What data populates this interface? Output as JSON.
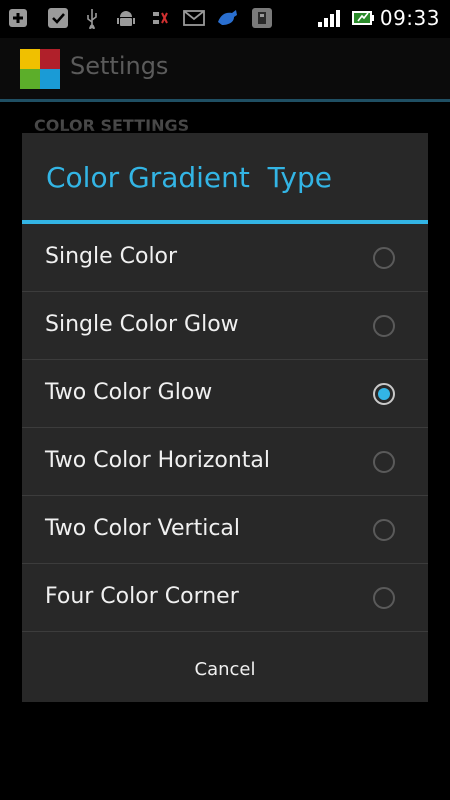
{
  "status_bar": {
    "time": "09:33",
    "left_icons": [
      "add-box-icon",
      "check-box-icon",
      "usb-icon",
      "android-debug-icon",
      "data-transfer-icon",
      "email-icon",
      "app-notification-icon",
      "sd-card-icon"
    ],
    "right_icons": [
      "signal-icon",
      "battery-charging-icon"
    ]
  },
  "app_bar": {
    "title": "Settings",
    "logo_colors": [
      "#f0c000",
      "#b0202a",
      "#5cae2a",
      "#1a9bd6"
    ]
  },
  "section_header": "COLOR SETTINGS",
  "dialog": {
    "title": "Color Gradient  Type",
    "options": [
      {
        "label": "Single Color",
        "checked": false
      },
      {
        "label": "Single Color Glow",
        "checked": false
      },
      {
        "label": "Two Color Glow",
        "checked": true
      },
      {
        "label": "Two Color Horizontal",
        "checked": false
      },
      {
        "label": "Two Color Vertical",
        "checked": false
      },
      {
        "label": "Four Color Corner",
        "checked": false
      }
    ],
    "cancel_label": "Cancel"
  },
  "colors": {
    "accent": "#33b5e5",
    "dialog_bg": "#282828"
  }
}
